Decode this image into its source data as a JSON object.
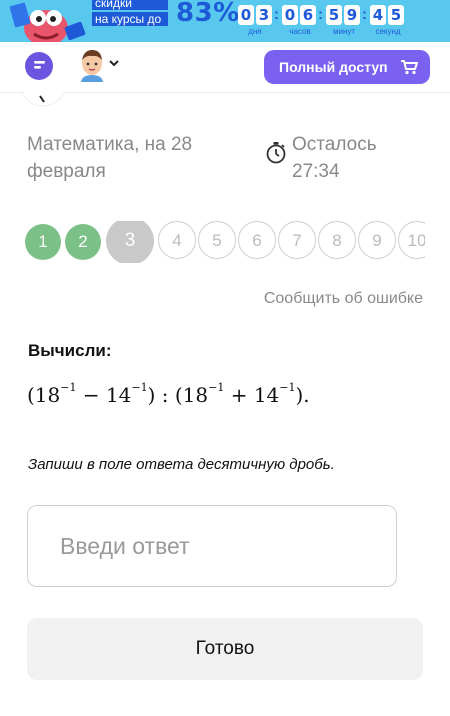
{
  "banner": {
    "promo_line1": "скидки",
    "promo_line2": "на курсы до",
    "discount": "83%",
    "countdown": {
      "days": [
        "0",
        "3"
      ],
      "hours": [
        "0",
        "6"
      ],
      "minutes": [
        "5",
        "9"
      ],
      "seconds": [
        "4",
        "5"
      ],
      "days_label": "дня",
      "hours_label": "часов",
      "minutes_label": "минут",
      "seconds_label": "секунд"
    },
    "background_color": "#59c8ef",
    "accent_color": "#1e5ad8"
  },
  "header": {
    "chat_icon": "chat-icon",
    "avatar_icon": "user-avatar",
    "full_access_label": "Полный доступ",
    "cart_icon": "cart-icon",
    "accent_color": "#7b61f0"
  },
  "quiz": {
    "subject": "Математика, на 28 февраля",
    "timer_label": "Осталось",
    "timer_value": "27:34",
    "questions": [
      "1",
      "2",
      "3",
      "4",
      "5",
      "6",
      "7",
      "8",
      "9",
      "10"
    ],
    "answered_color": "#7bc086",
    "current_color": "#c9c9c9",
    "report_label": "Сообщить об ошибке"
  },
  "task": {
    "label": "Вычисли:",
    "formula": {
      "p1": "(18",
      "e1": "−1",
      "p2": " − 14",
      "e2": "−1",
      "p3": ") : (18",
      "e3": "−1",
      "p4": " + 14",
      "e4": "−1",
      "p5": ")."
    },
    "hint": "Запиши в поле ответа десятичную дробь.",
    "answer_placeholder": "Введи ответ",
    "answer_value": "",
    "submit_label": "Готово"
  }
}
